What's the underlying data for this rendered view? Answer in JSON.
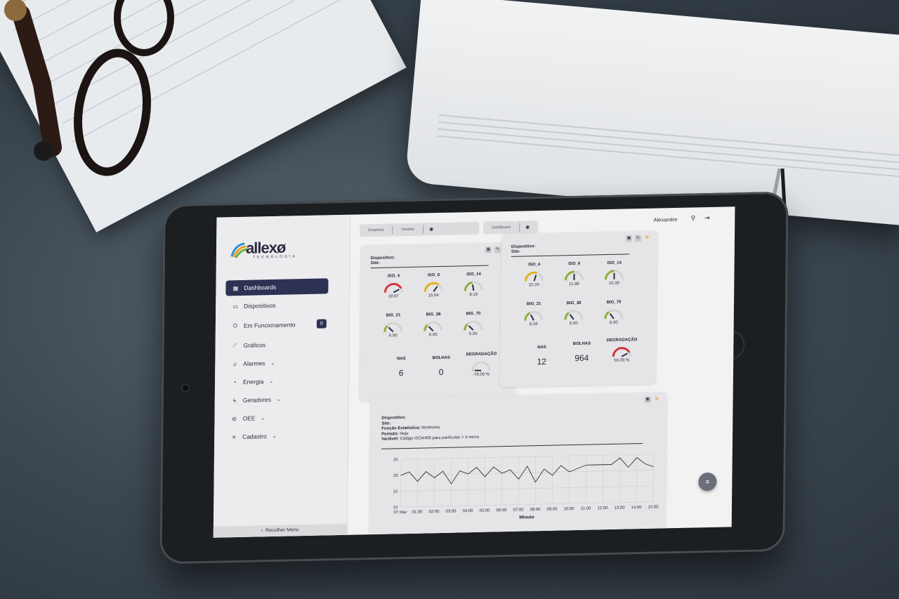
{
  "app": {
    "logo_word": "allexø",
    "logo_sub": "TECNOLOGIA",
    "user_name": "Alexandre"
  },
  "topbar": {
    "tab_empresa": "Empresa",
    "tab_usuario": "Usuário",
    "tab_dashboard": "Dashboard"
  },
  "sidebar": {
    "items": [
      {
        "label": "Dashboards",
        "icon": "dashboard-icon"
      },
      {
        "label": "Dispositivos",
        "icon": "device-icon"
      },
      {
        "label": "Em Funcionamento",
        "icon": "power-icon",
        "badge": "0"
      },
      {
        "label": "Gráficos",
        "icon": "chart-icon"
      },
      {
        "label": "Alarmes",
        "icon": "bell-icon"
      },
      {
        "label": "Energia",
        "icon": "gauge-icon"
      },
      {
        "label": "Geradores",
        "icon": "bolt-icon"
      },
      {
        "label": "OEE",
        "icon": "oee-icon"
      },
      {
        "label": "Cadastro",
        "icon": "register-icon"
      }
    ],
    "collapse_label": "Recolher Menu"
  },
  "card1": {
    "device_label": "Dispositivo:",
    "site_label": "Site:",
    "gauges": [
      {
        "label": "ISO_4",
        "value": "18.97",
        "color": "#d9343a",
        "level": 0.85
      },
      {
        "label": "ISO_6",
        "value": "15.04",
        "color": "#e2b21b",
        "level": 0.7
      },
      {
        "label": "ISO_14",
        "value": "9.19",
        "color": "#8ab03a",
        "level": 0.45
      },
      {
        "label": "BIG_21",
        "value": "6.00",
        "color": "#8ab03a",
        "level": 0.25
      },
      {
        "label": "BIG_38",
        "value": "6.00",
        "color": "#8ab03a",
        "level": 0.25
      },
      {
        "label": "BIG_70",
        "value": "6.00",
        "color": "#8ab03a",
        "level": 0.25
      }
    ],
    "nas_label": "NAS",
    "nas_value": "6",
    "bolhas_label": "BOLHAS",
    "bolhas_value": "0",
    "degradacao_label": "DEGRADAÇÃO",
    "degradacao_value": "-76.00 %",
    "degradacao_color": "#8ab03a",
    "degradacao_level": 0.02
  },
  "card2": {
    "device_label": "Dispositivo:",
    "site_label": "Site:",
    "gauges": [
      {
        "label": "ISO_4",
        "value": "22.25",
        "color": "#e2b21b",
        "level": 0.6
      },
      {
        "label": "ISO_6",
        "value": "11.88",
        "color": "#8ab03a",
        "level": 0.5
      },
      {
        "label": "ISO_14",
        "value": "10.39",
        "color": "#8ab03a",
        "level": 0.5
      },
      {
        "label": "BIG_21",
        "value": "8.56",
        "color": "#8ab03a",
        "level": 0.35
      },
      {
        "label": "BIG_38",
        "value": "6.00",
        "color": "#8ab03a",
        "level": 0.3
      },
      {
        "label": "BIG_70",
        "value": "6.00",
        "color": "#8ab03a",
        "level": 0.3
      }
    ],
    "nas_label": "NAS",
    "nas_value": "12",
    "bolhas_label": "BOLHAS",
    "bolhas_value": "964",
    "degradacao_label": "DEGRADAÇÃO",
    "degradacao_value": "56.00 %",
    "degradacao_color": "#d9343a",
    "degradacao_level": 0.85
  },
  "chart_card": {
    "device_label": "Dispositivo:",
    "site_label": "Site:",
    "func_label": "Função Estatística:",
    "func_value": "Nenhuma",
    "period_label": "Período:",
    "period_value": "Hoje",
    "var_label": "Variável:",
    "var_value": "Código ISO4406 para partículas > 4 micra"
  },
  "chart_data": {
    "type": "line",
    "xlabel": "Minuto",
    "ylabel": "",
    "ylim": [
      10,
      25
    ],
    "yticks": [
      10,
      15,
      20,
      25
    ],
    "xticks": [
      "07 Mar",
      "01:00",
      "02:00",
      "03:00",
      "04:00",
      "05:00",
      "06:00",
      "07:00",
      "08:00",
      "09:00",
      "10:00",
      "11:00",
      "12:00",
      "13:00",
      "14:00",
      "15:00"
    ],
    "x_hours": [
      0,
      0.5,
      1,
      1.5,
      2,
      2.5,
      3,
      3.5,
      4,
      4.5,
      5,
      5.5,
      6,
      6.5,
      7,
      7.5,
      8,
      8.5,
      9,
      9.5,
      10,
      10.5,
      11,
      11.5,
      12,
      12.5,
      13,
      13.5,
      14,
      14.5,
      15
    ],
    "values": [
      20,
      21,
      18,
      21,
      19,
      21,
      17,
      21,
      20,
      22,
      19,
      22,
      20,
      21,
      18,
      22,
      17,
      21,
      19,
      22,
      20,
      21,
      22,
      22,
      22,
      22,
      24,
      21,
      24,
      22,
      21
    ],
    "grid": true,
    "color": "#333333"
  }
}
